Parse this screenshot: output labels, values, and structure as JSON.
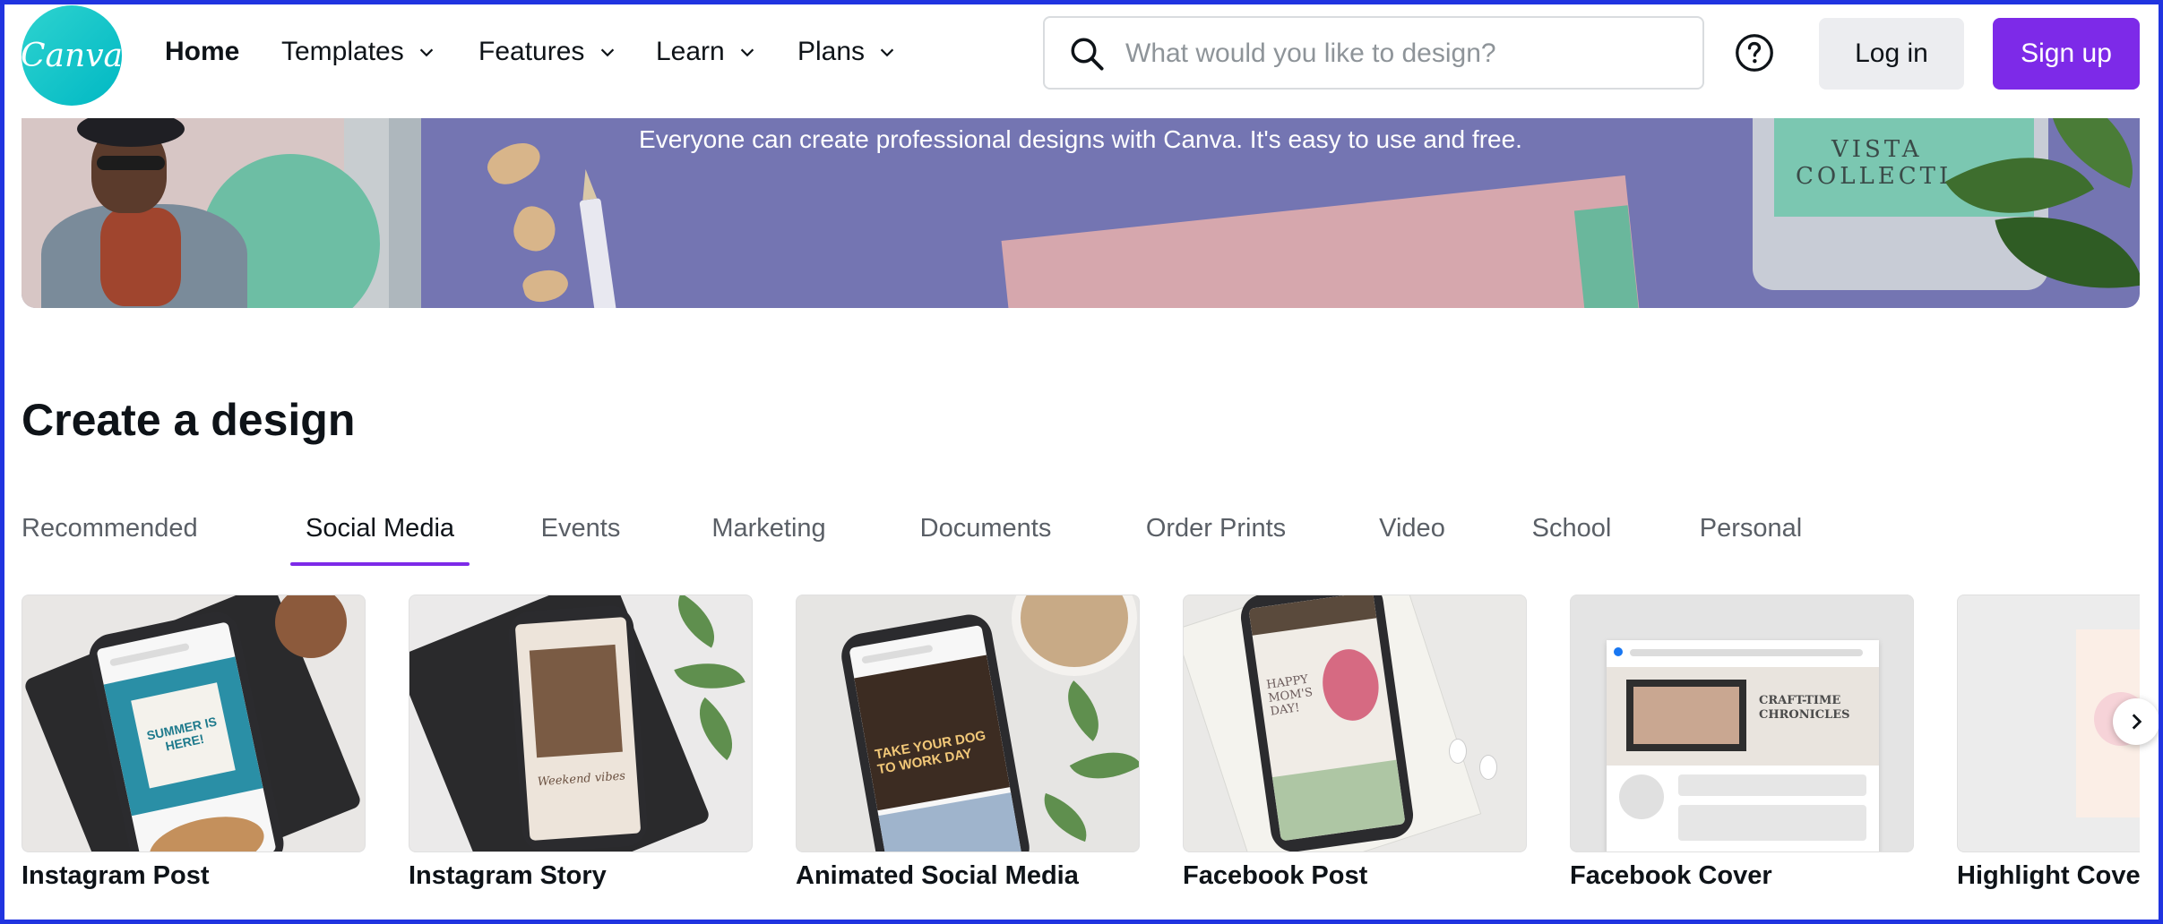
{
  "header": {
    "logo_text": "Canva",
    "nav": [
      {
        "label": "Home",
        "has_dropdown": false,
        "active": true
      },
      {
        "label": "Templates",
        "has_dropdown": true
      },
      {
        "label": "Features",
        "has_dropdown": true
      },
      {
        "label": "Learn",
        "has_dropdown": true
      },
      {
        "label": "Plans",
        "has_dropdown": true
      }
    ],
    "search": {
      "placeholder": "What would you like to design?",
      "value": ""
    },
    "help_icon": "question-circle-icon",
    "login_label": "Log in",
    "signup_label": "Sign up"
  },
  "hero": {
    "tagline": "Everyone can create professional designs with Canva. It's easy to use and free.",
    "mockup_text": [
      "VISTA",
      "COLLECTI"
    ]
  },
  "create": {
    "title": "Create a design",
    "tabs": [
      {
        "label": "Recommended"
      },
      {
        "label": "Social Media",
        "active": true
      },
      {
        "label": "Events"
      },
      {
        "label": "Marketing"
      },
      {
        "label": "Documents"
      },
      {
        "label": "Order Prints"
      },
      {
        "label": "Video"
      },
      {
        "label": "School"
      },
      {
        "label": "Personal"
      }
    ],
    "cards": [
      {
        "label": "Instagram Post",
        "thumb_text": "SUMMER IS HERE!"
      },
      {
        "label": "Instagram Story",
        "thumb_text": "Weekend vibes"
      },
      {
        "label": "Animated Social Media",
        "thumb_text": "TAKE YOUR DOG TO WORK DAY"
      },
      {
        "label": "Facebook Post",
        "thumb_text": "HAPPY MOM'S DAY!"
      },
      {
        "label": "Facebook Cover",
        "thumb_text": "CRAFT-TIME CHRONICLES"
      },
      {
        "label": "Highlight Cover",
        "thumb_text": ""
      }
    ]
  },
  "colors": {
    "brand_purple": "#7d2ae8",
    "logo_teal": "#00c4cc",
    "hero_bg": "#7475b2",
    "frame_border": "#2034e0"
  }
}
